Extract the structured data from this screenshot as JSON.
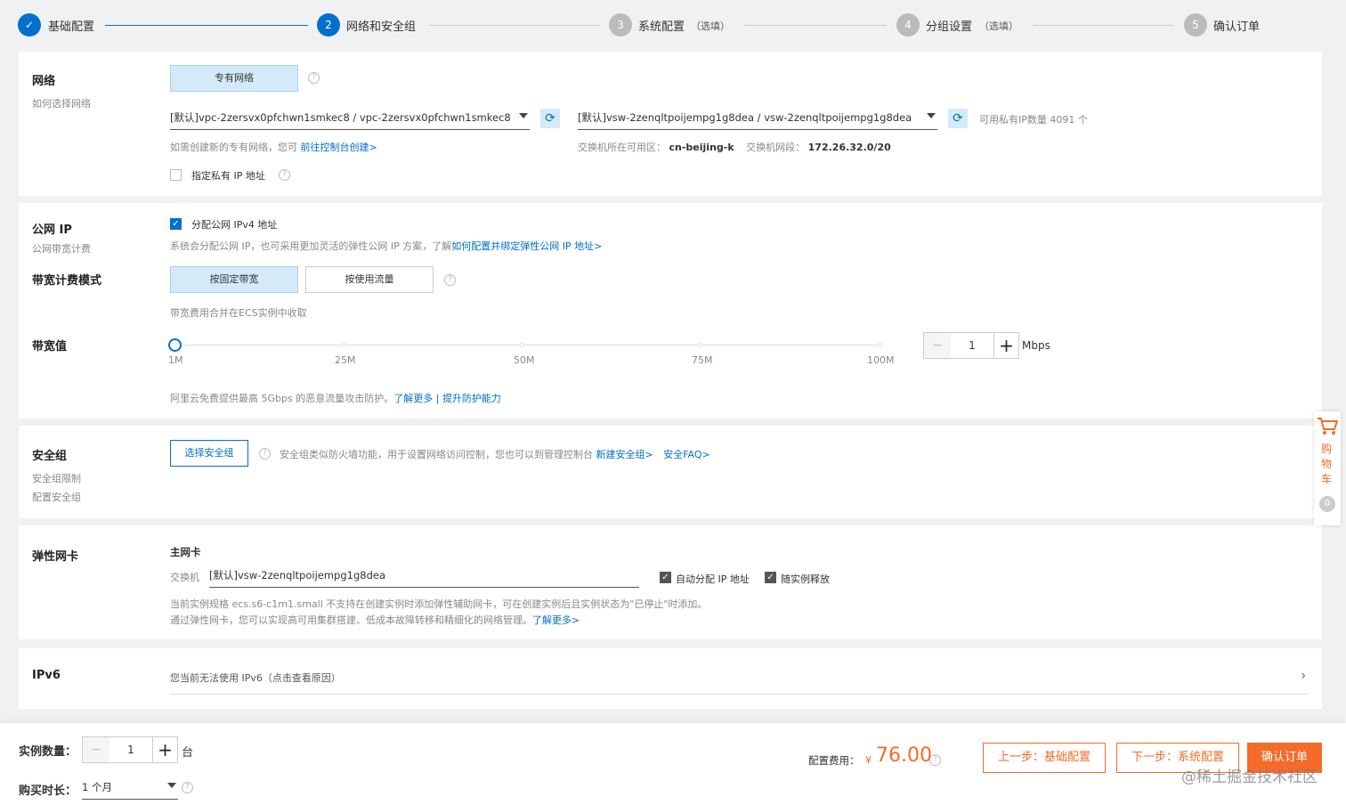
{
  "colors": {
    "primary": "#0070cc",
    "accent_orange": "#f56b2a",
    "step_inactive": "#bbbbbb"
  },
  "steps": [
    {
      "num": "✓",
      "label": "基础配置",
      "optional": ""
    },
    {
      "num": "2",
      "label": "网络和安全组",
      "optional": ""
    },
    {
      "num": "3",
      "label": "系统配置",
      "optional": "（选填）"
    },
    {
      "num": "4",
      "label": "分组设置",
      "optional": "（选填）"
    },
    {
      "num": "5",
      "label": "确认订单",
      "optional": ""
    }
  ],
  "network": {
    "title": "网络",
    "subtitle": "如何选择网络",
    "type_button": "专有网络",
    "vpc_select": "[默认]vpc-2zersvx0pfchwn1smkec8 / vpc-2zersvx0pfchwn1smkec8",
    "vsw_select": "[默认]vsw-2zenqltpoijempg1g8dea / vsw-2zenqltpoijempg1g8dea",
    "available_ip": "可用私有IP数量 4091 个",
    "create_hint": "如需创建新的专有网络，您可",
    "create_link": "前往控制台创建>",
    "zone_label": "交换机所在可用区：",
    "zone_value": "cn-beijing-k",
    "cidr_label": "交换机网段：",
    "cidr_value": "172.26.32.0/20",
    "private_ip_label": "指定私有 IP 地址"
  },
  "public_ip": {
    "title": "公网 IP",
    "subtitle": "公网带宽计费",
    "assign_label": "分配公网 IPv4 地址",
    "desc": "系统会分配公网 IP，也可采用更加灵活的弹性公网 IP 方案，了解",
    "desc_link": "如何配置并绑定弹性公网 IP 地址>",
    "billing_title": "带宽计费模式",
    "billing_fixed": "按固定带宽",
    "billing_traffic": "按使用流量",
    "billing_note": "带宽费用合并在ECS实例中收取",
    "bandwidth_title": "带宽值",
    "bandwidth_value": "1",
    "bandwidth_unit": "Mbps",
    "bandwidth_fraction": 0,
    "slider_ticks": [
      "1M",
      "25M",
      "50M",
      "75M",
      "100M"
    ],
    "ddos_note": "阿里云免费提供最高 5Gbps 的恶意流量攻击防护。",
    "ddos_link1": "了解更多",
    "ddos_sep": "|",
    "ddos_link2": "提升防护能力"
  },
  "security_group": {
    "title": "安全组",
    "sub1": "安全组限制",
    "sub2": "配置安全组",
    "select_button": "选择安全组",
    "desc": "安全组类似防火墙功能，用于设置网络访问控制，您也可以到管理控制台",
    "link_new": "新建安全组>",
    "link_faq": "安全FAQ>"
  },
  "eni": {
    "title": "弹性网卡",
    "primary_label": "主网卡",
    "switch_label": "交换机",
    "switch_value": "[默认]vsw-2zenqltpoijempg1g8dea",
    "auto_ip_label": "自动分配 IP 地址",
    "release_label": "随实例释放",
    "note1": "当前实例规格 ecs.s6-c1m1.small 不支持在创建实例时添加弹性辅助网卡，可在创建实例后且实例状态为\"已停止\"时添加。",
    "note2": "通过弹性网卡，您可以实现高可用集群搭建、低成本故障转移和精细化的网络管理。",
    "note2_link": "了解更多>"
  },
  "ipv6": {
    "title": "IPv6",
    "desc": "您当前无法使用 IPv6（点击查看原因）"
  },
  "footer": {
    "count_label": "实例数量：",
    "count_value": "1",
    "count_unit": "台",
    "duration_label": "购买时长：",
    "duration_value": "1 个月",
    "fee_label": "配置费用：",
    "currency": "¥",
    "price": "76.00",
    "prev_button": "上一步：基础配置",
    "next_button": "下一步：系统配置",
    "confirm_button": "确认订单"
  },
  "cart": {
    "label": "购物车",
    "count": "0"
  },
  "watermark": "@稀土掘金技术社区"
}
